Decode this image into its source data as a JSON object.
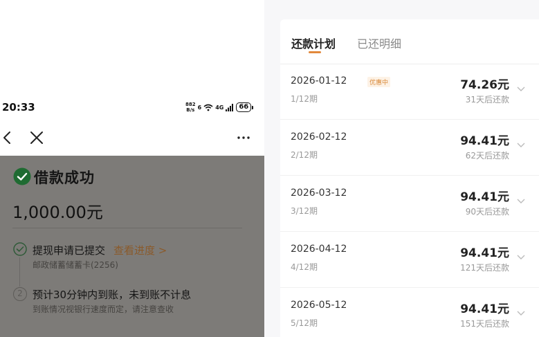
{
  "status_bar": {
    "time": "20:33",
    "net_speed_value": "882",
    "net_speed_unit": "B/s",
    "wifi_label": "6",
    "cell_label": "4G",
    "battery": "66"
  },
  "loan": {
    "title": "借款成功",
    "amount": "1,000.00元",
    "steps": [
      {
        "title": "提现申请已提交",
        "link": "查看进度 >",
        "sub": "邮政储蓄储蓄卡(2256)"
      },
      {
        "number": "2",
        "title": "预计30分钟内到账，未到账不计息",
        "sub": "到账情况视银行速度而定，请注意查收"
      }
    ]
  },
  "schedule": {
    "tabs": [
      "还款计划",
      "已还明细"
    ],
    "active_tab": 0,
    "accent_color": "#e2893c",
    "installments": [
      {
        "date": "2026-01-12",
        "badge": "优惠中",
        "period": "1/12期",
        "amount": "74.26元",
        "due": "31天后还款"
      },
      {
        "date": "2026-02-12",
        "period": "2/12期",
        "amount": "94.41元",
        "due": "62天后还款"
      },
      {
        "date": "2026-03-12",
        "period": "3/12期",
        "amount": "94.41元",
        "due": "90天后还款"
      },
      {
        "date": "2026-04-12",
        "period": "4/12期",
        "amount": "94.41元",
        "due": "121天后还款"
      },
      {
        "date": "2026-05-12",
        "period": "5/12期",
        "amount": "94.41元",
        "due": "151天后还款"
      }
    ]
  },
  "icons": {
    "back": "chevron-left-icon",
    "close": "close-icon",
    "more": "more-icon",
    "success": "check-circle-icon",
    "row_expand": "chevron-down-icon"
  }
}
